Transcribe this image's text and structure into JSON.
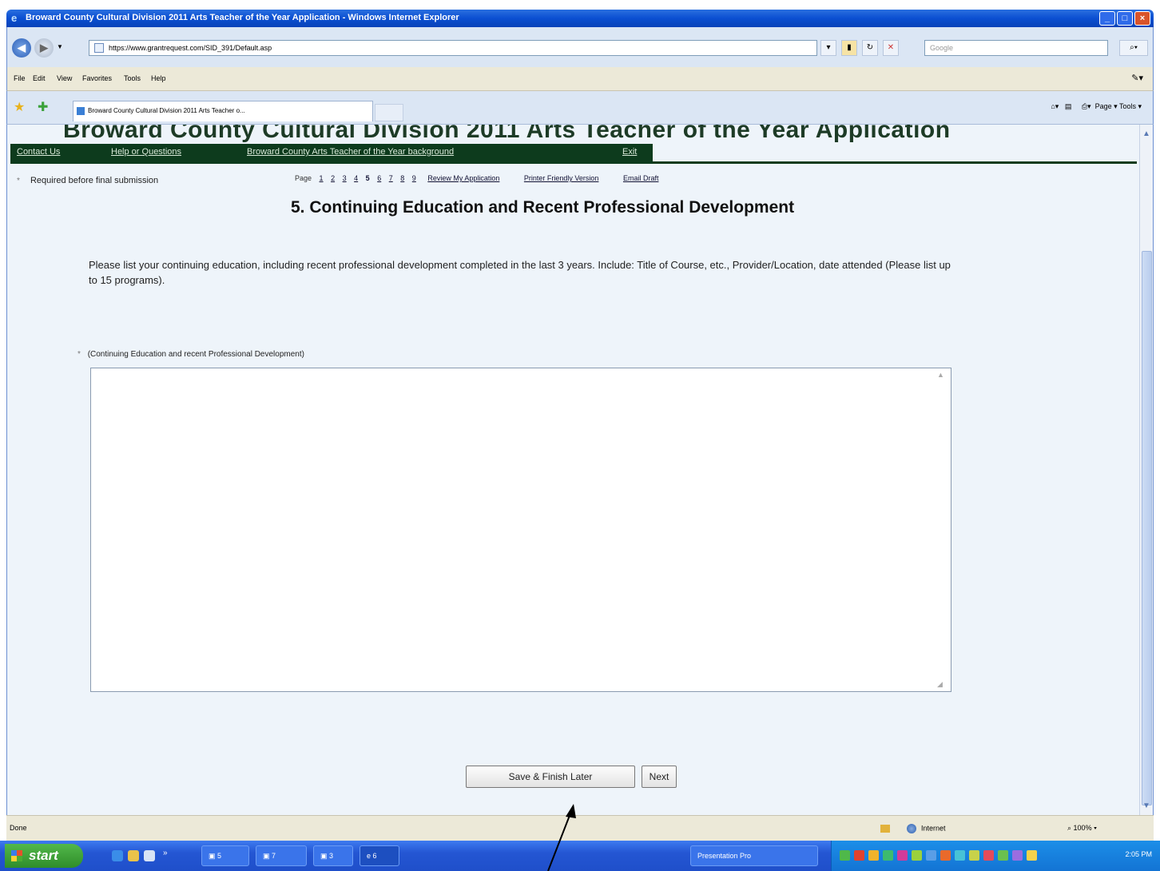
{
  "window": {
    "title": "Broward County Cultural Division 2011 Arts Teacher of the Year Application - Windows Internet Explorer",
    "controls": [
      "minimize",
      "maximize",
      "close"
    ]
  },
  "browser": {
    "address": "https://www.grantrequest.com/SID_391/Default.asp",
    "search_placeholder": "Google",
    "menu": [
      "File",
      "Edit",
      "View",
      "Favorites",
      "Tools",
      "Help"
    ],
    "tab_title": "Broward County Cultural Division 2011 Arts Teacher o...",
    "command_bar": "Page ▾   Tools ▾"
  },
  "page": {
    "banner": "Broward County Cultural Division 2011 Arts Teacher of the Year Application",
    "nav_links": [
      "Contact Us",
      "Help or Questions",
      "Broward County Arts Teacher of the Year background",
      "Exit"
    ],
    "required_marker": "*",
    "required_note": "Required before final submission",
    "page_label": "Page",
    "pages": [
      "1",
      "2",
      "3",
      "4",
      "5",
      "6",
      "7",
      "8",
      "9"
    ],
    "current_page": "5",
    "review_link": "Review My Application",
    "printer_link": "Printer Friendly Version",
    "email_link": "Email Draft",
    "heading": "5. Continuing Education and Recent Professional Development",
    "instructions": "Please list your continuing education, including recent professional development completed in the last 3 years. Include: Title of Course, etc., Provider/Location, date attended (Please list up to 15 programs).",
    "field_label": "(Continuing Education and recent Professional Development)",
    "field_value": "",
    "save_button": "Save & Finish Later",
    "next_button": "Next"
  },
  "status": {
    "text": "Done",
    "zone": "Internet",
    "zoom": "100%"
  },
  "taskbar": {
    "start": "start",
    "buttons": [
      "5",
      "7",
      "3",
      "6"
    ],
    "tray_item": "Presentation Pro",
    "clock": "2:05 PM"
  },
  "colors": {
    "nav_bar": "#0d3b1d",
    "page_bg": "#eef4fa",
    "title_bar": "#0b4fd1"
  }
}
